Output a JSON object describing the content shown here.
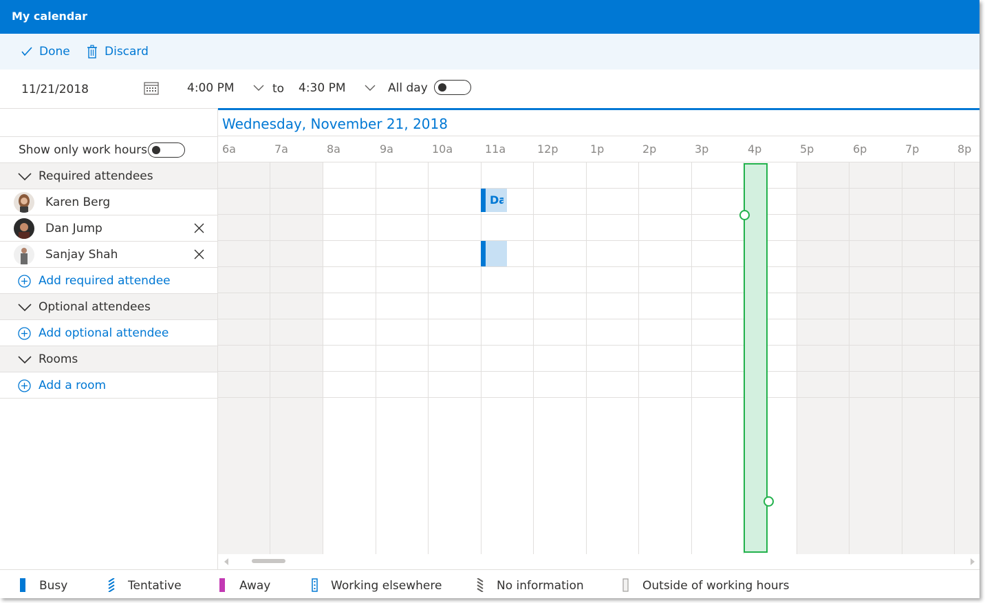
{
  "window": {
    "title": "My calendar"
  },
  "toolbar": {
    "done_label": "Done",
    "discard_label": "Discard"
  },
  "datebar": {
    "date": "11/21/2018",
    "start_time": "4:00 PM",
    "to_label": "to",
    "end_time": "4:30 PM",
    "all_day_label": "All day"
  },
  "scheduler": {
    "day_title": "Wednesday, November 21, 2018",
    "work_hours_label": "Show only work hours",
    "hours": [
      "6a",
      "7a",
      "8a",
      "9a",
      "10a",
      "11a",
      "12p",
      "1p",
      "2p",
      "3p",
      "4p",
      "5p",
      "6p",
      "7p",
      "8p"
    ]
  },
  "required": {
    "header": "Required attendees",
    "attendees": [
      {
        "name": "Karen Berg",
        "removable": false
      },
      {
        "name": "Dan Jump",
        "removable": true
      },
      {
        "name": "Sanjay Shah",
        "removable": true
      }
    ],
    "add_label": "Add required attendee"
  },
  "optional": {
    "header": "Optional attendees",
    "add_label": "Add optional attendee"
  },
  "rooms": {
    "header": "Rooms",
    "add_label": "Add a room"
  },
  "busy_blocks": [
    {
      "attendee": "Karen Berg",
      "label": "Da",
      "start": "11a",
      "end": "11:30a"
    },
    {
      "attendee": "Sanjay Shah",
      "label": "",
      "start": "11a",
      "end": "11:30a"
    }
  ],
  "legend": {
    "busy": "Busy",
    "tentative": "Tentative",
    "away": "Away",
    "working_elsewhere": "Working elsewhere",
    "no_information": "No information",
    "outside_hours": "Outside of working hours"
  },
  "colors": {
    "accent": "#0078d4",
    "selection": "#22b14c",
    "away": "#c239b3"
  }
}
